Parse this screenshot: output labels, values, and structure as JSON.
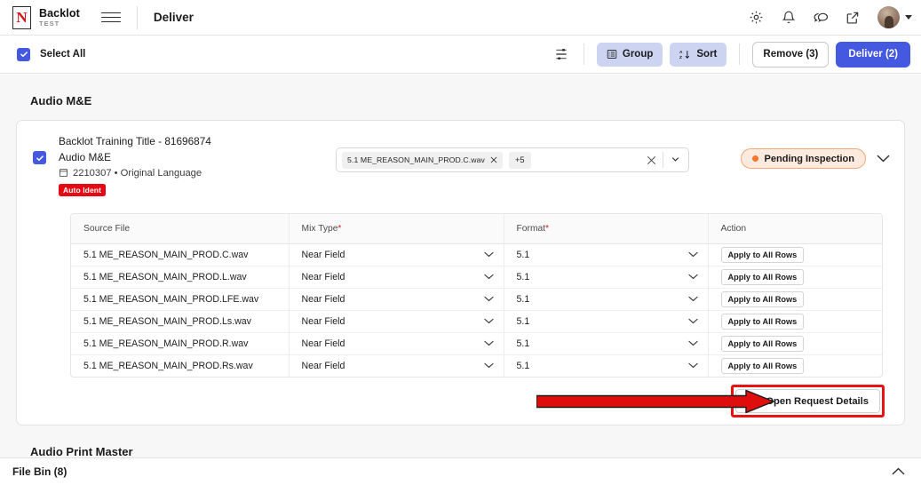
{
  "topbar": {
    "brand_name": "Backlot",
    "brand_env": "TEST",
    "page_title": "Deliver",
    "icons": [
      {
        "name": "gear-icon",
        "label": "Settings"
      },
      {
        "name": "bell-icon",
        "label": "Notifications"
      },
      {
        "name": "chat-icon",
        "label": "Support Chat"
      },
      {
        "name": "external-link-icon",
        "label": "Open in new window"
      }
    ]
  },
  "actionbar": {
    "select_all_label": "Select All",
    "filter_icon": "sliders-icon",
    "group_label": "Group",
    "sort_label": "Sort",
    "remove_label": "Remove (3)",
    "deliver_label": "Deliver (2)",
    "accent_color": "#4458e0",
    "soft_button_color": "#ccd4f2"
  },
  "section": {
    "title": "Audio M&E",
    "next_title": "Audio Print Master"
  },
  "asset": {
    "title": "Backlot Training Title - 81696874",
    "type": "Audio M&E",
    "id": "2210307 • Original Language",
    "badge": "Auto Ident",
    "badge_color": "#e50914",
    "file_chip": "5.1 ME_REASON_MAIN_PROD.C.wav",
    "extra_count": "+5",
    "status": "Pending Inspection",
    "status_color": "#f2762e",
    "status_bg": "#fdeade"
  },
  "table": {
    "columns": [
      {
        "label": "Source File",
        "required": false
      },
      {
        "label": "Mix Type",
        "required": true
      },
      {
        "label": "Format",
        "required": true
      },
      {
        "label": "Action",
        "required": false
      }
    ],
    "required_marker": "*",
    "rows": [
      {
        "source": "5.1 ME_REASON_MAIN_PROD.C.wav",
        "mix": "Near Field",
        "format": "5.1",
        "action": "Apply to All Rows"
      },
      {
        "source": "5.1 ME_REASON_MAIN_PROD.L.wav",
        "mix": "Near Field",
        "format": "5.1",
        "action": "Apply to All Rows"
      },
      {
        "source": "5.1 ME_REASON_MAIN_PROD.LFE.wav",
        "mix": "Near Field",
        "format": "5.1",
        "action": "Apply to All Rows"
      },
      {
        "source": "5.1 ME_REASON_MAIN_PROD.Ls.wav",
        "mix": "Near Field",
        "format": "5.1",
        "action": "Apply to All Rows"
      },
      {
        "source": "5.1 ME_REASON_MAIN_PROD.R.wav",
        "mix": "Near Field",
        "format": "5.1",
        "action": "Apply to All Rows"
      },
      {
        "source": "5.1 ME_REASON_MAIN_PROD.Rs.wav",
        "mix": "Near Field",
        "format": "5.1",
        "action": "Apply to All Rows"
      }
    ]
  },
  "footer": {
    "open_request_label": "Open Request Details",
    "highlight_color": "#e81313"
  },
  "filebin": {
    "label": "File Bin (8)",
    "chevron": "chevron-up-icon"
  }
}
